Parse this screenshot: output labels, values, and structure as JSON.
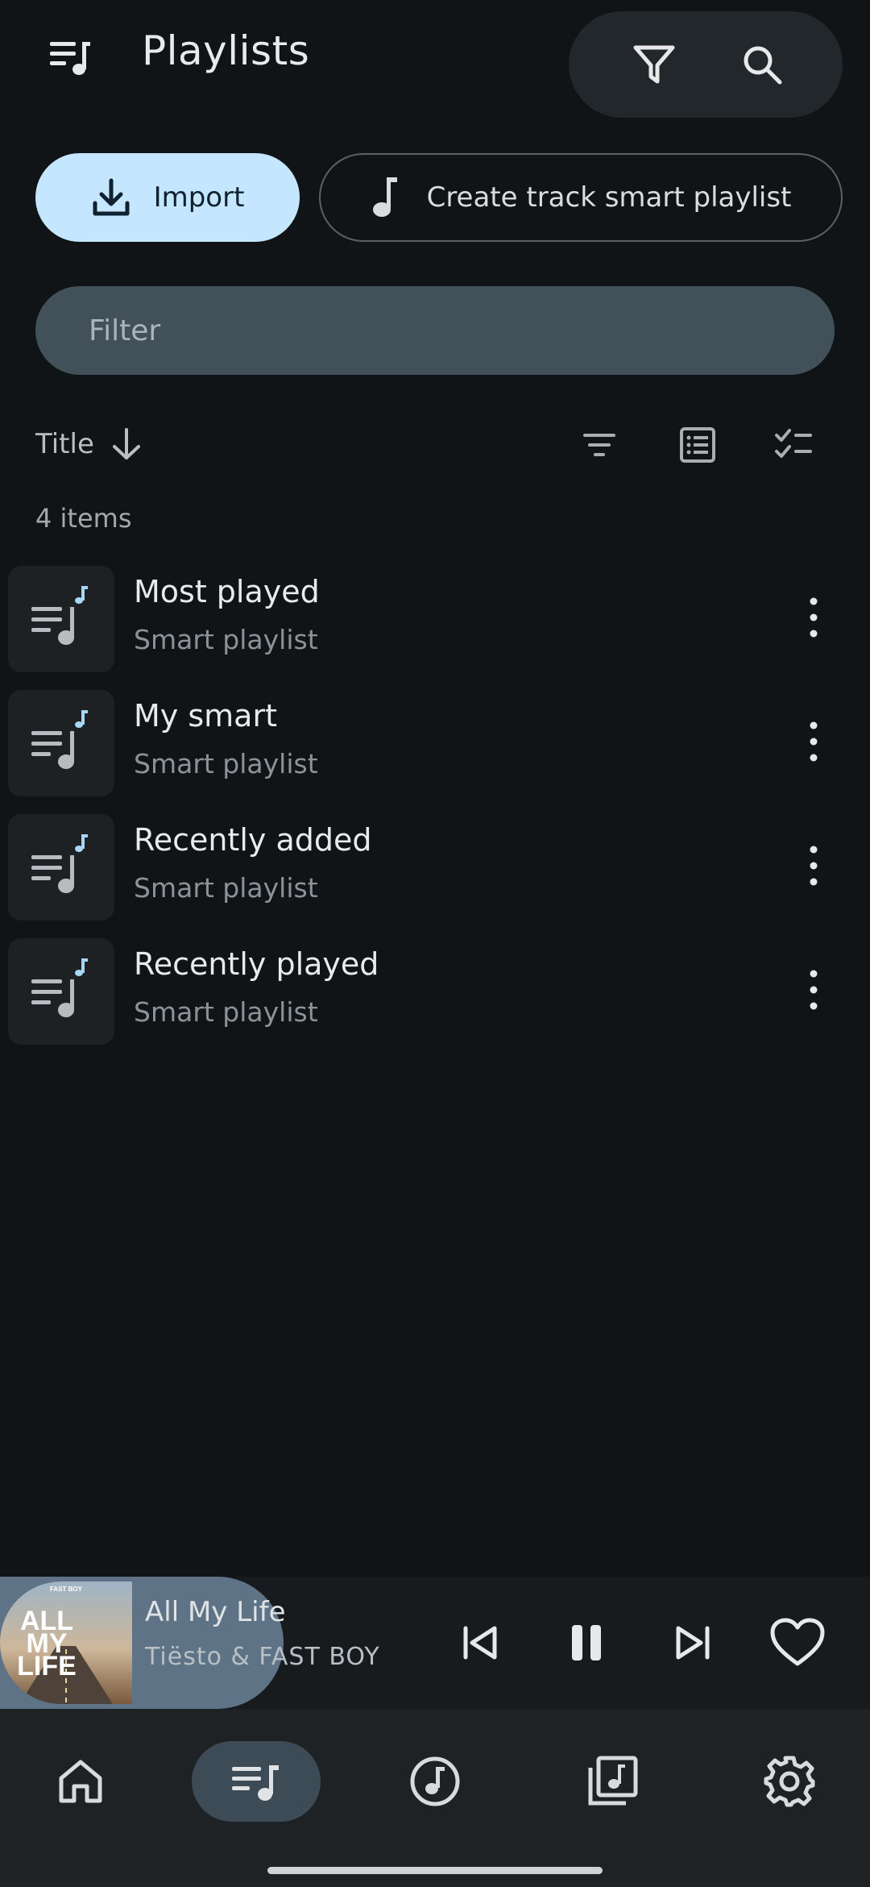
{
  "header": {
    "title": "Playlists",
    "icons": [
      "playlist-icon",
      "filter-icon",
      "search-icon"
    ]
  },
  "actions": {
    "import_label": "Import",
    "create_label": "Create track smart playlist"
  },
  "filter": {
    "placeholder": "Filter"
  },
  "sort": {
    "label": "Title",
    "direction": "descending-arrow"
  },
  "list": {
    "count": "4 items",
    "items": [
      {
        "title": "Most played",
        "subtitle": "Smart playlist"
      },
      {
        "title": "My smart",
        "subtitle": "Smart playlist"
      },
      {
        "title": "Recently added",
        "subtitle": "Smart playlist"
      },
      {
        "title": "Recently played",
        "subtitle": "Smart playlist"
      }
    ]
  },
  "player": {
    "title": "All My Life",
    "artist": "Tiësto & FAST BOY",
    "art_text": {
      "top": "FAST BOY",
      "line1": "ALL",
      "line2": "MY",
      "line3": "LIFE"
    },
    "progress_fraction": 0.33,
    "state": "playing"
  },
  "nav": {
    "items": [
      "home",
      "playlists",
      "tracks",
      "albums",
      "settings"
    ],
    "active": "playlists"
  },
  "colors": {
    "background": "#111416",
    "accent": "#c5e6ff",
    "note_accent": "#a9d6f5"
  }
}
